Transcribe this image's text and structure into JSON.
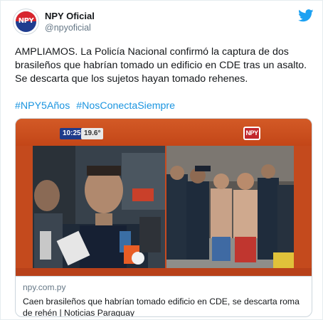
{
  "account": {
    "display_name": "NPY Oficial",
    "handle": "@npyoficial",
    "avatar_text": "NPY"
  },
  "tweet": {
    "text": "AMPLIAMOS. La Policía Nacional confirmó la captura de dos brasileños que habrían tomado un edificio en CDE tras un asalto. Se descarta que los sujetos hayan tomado rehenes.",
    "hashtags": [
      "#NPY5Años",
      "#NosConectaSiempre"
    ]
  },
  "card": {
    "image": {
      "clock": "10:25",
      "temperature": "19.6°",
      "channel_logo": "NPY"
    },
    "domain": "npy.com.py",
    "title": "Caen brasileños que habrían tomado edificio en CDE, se descarta roma de rehén | Noticias Paraguay"
  },
  "icons": {
    "twitter": "twitter-bird-icon"
  },
  "colors": {
    "brand_blue": "#1da1f2",
    "hashtag_blue": "#1b95e0",
    "frame_orange": "#c74a20",
    "npy_red": "#d8262e",
    "npy_navy": "#1f3c8f"
  }
}
